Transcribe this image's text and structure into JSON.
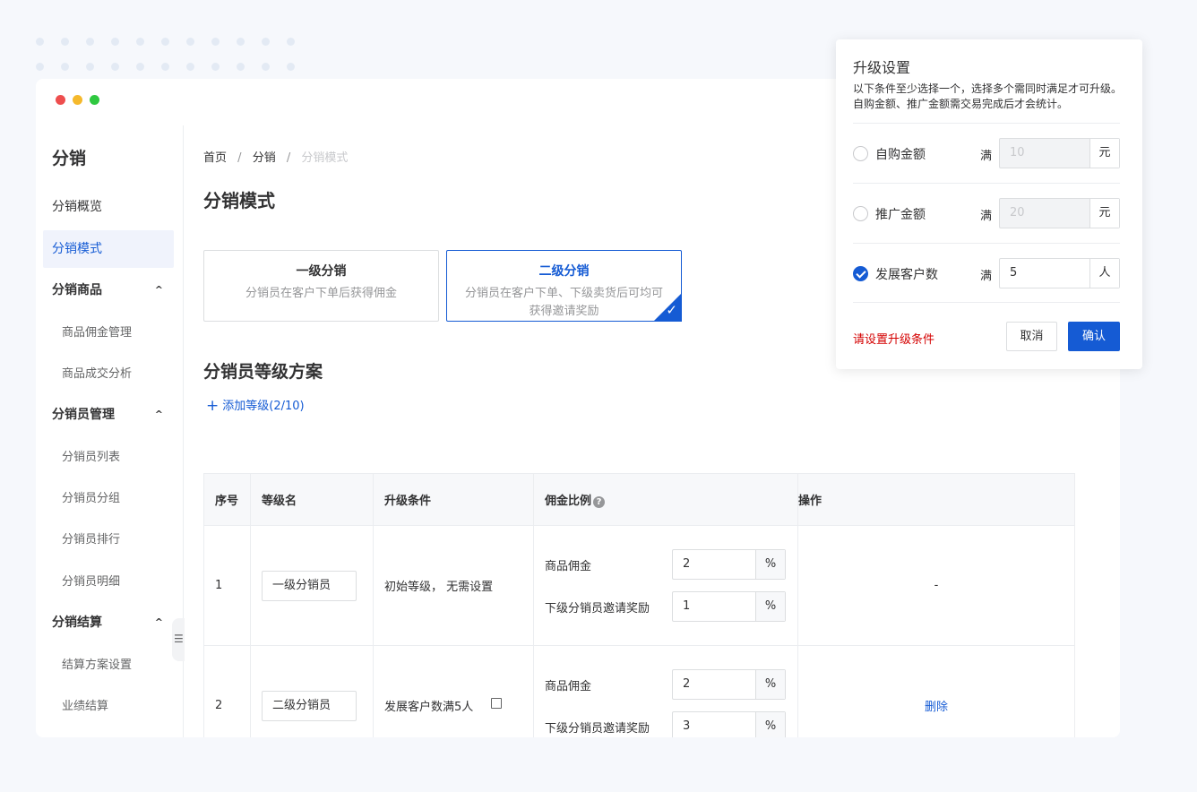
{
  "sidebar": {
    "title": "分销",
    "items": [
      {
        "label": "分销概览"
      },
      {
        "label": "分销模式"
      },
      {
        "label": "分销商品"
      },
      {
        "label": "商品佣金管理"
      },
      {
        "label": "商品成交分析"
      },
      {
        "label": "分销员管理"
      },
      {
        "label": "分销员列表"
      },
      {
        "label": "分销员分组"
      },
      {
        "label": "分销员排行"
      },
      {
        "label": "分销员明细"
      },
      {
        "label": "分销结算"
      },
      {
        "label": "结算方案设置"
      },
      {
        "label": "业绩结算"
      }
    ],
    "active": "分销模式"
  },
  "breadcrumb": {
    "home": "首页",
    "parent": "分销",
    "current": "分销模式",
    "sep": "/"
  },
  "page_title": "分销模式",
  "modes": [
    {
      "title": "一级分销",
      "desc": "分销员在客户下单后获得佣金"
    },
    {
      "title": "二级分销",
      "desc": "分销员在客户下单、下级卖货后可均可获得邀请奖励"
    }
  ],
  "level_section": {
    "title": "分销员等级方案",
    "add_label": "添加等级(2/10)",
    "columns": [
      "序号",
      "等级名",
      "升级条件",
      "佣金比例",
      "操作"
    ],
    "rows": [
      {
        "index": "1",
        "name": "一级分销员",
        "condition": "初始等级， 无需设置",
        "commission_label": "商品佣金",
        "commission_value": "2",
        "commission_unit": "%",
        "invite_label": "下级分销员邀请奖励",
        "invite_value": "1",
        "invite_unit": "%",
        "action": "-"
      },
      {
        "index": "2",
        "name": "二级分销员",
        "condition": "发展客户数满5人",
        "commission_label": "商品佣金",
        "commission_value": "2",
        "commission_unit": "%",
        "invite_label": "下级分销员邀请奖励",
        "invite_value": "3",
        "invite_unit": "%",
        "action": "删除"
      }
    ]
  },
  "popover": {
    "title": "升级设置",
    "desc": "以下条件至少选择一个，选择多个需同时满足才可升级。自购金额、推广金额需交易完成后才会统计。",
    "options": [
      {
        "label": "自购金额",
        "prefix": "满",
        "value": "10",
        "unit": "元",
        "checked": false
      },
      {
        "label": "推广金额",
        "prefix": "满",
        "value": "20",
        "unit": "元",
        "checked": false
      },
      {
        "label": "发展客户数",
        "prefix": "满",
        "value": "5",
        "unit": "人",
        "checked": true
      }
    ],
    "warning": "请设置升级条件",
    "cancel_label": "取消",
    "confirm_label": "确认"
  },
  "colors": {
    "accent": "#155bd4",
    "warning": "#d40000",
    "traffic_red": "#ee4e4e",
    "traffic_yellow": "#f5b92c",
    "traffic_green": "#2fc840"
  }
}
